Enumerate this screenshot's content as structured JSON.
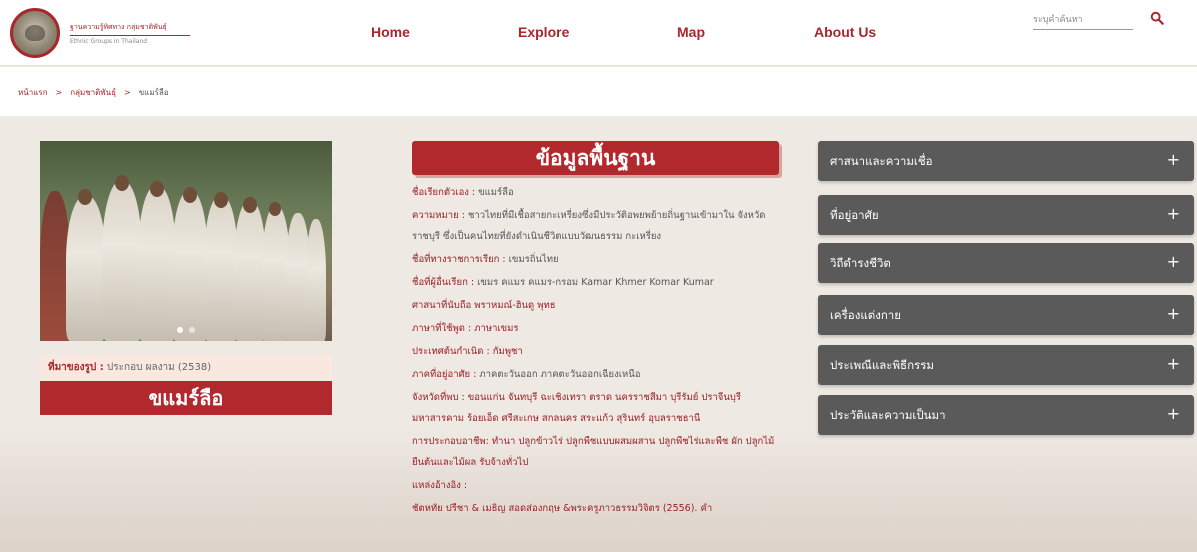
{
  "header": {
    "logo_line1": "ฐานความรู้ทิศทาง กลุ่มชาติพันธุ์",
    "logo_line2": "Ethnic Groups in Thailand",
    "nav": [
      {
        "label": "Home"
      },
      {
        "label": "Explore"
      },
      {
        "label": "Map"
      },
      {
        "label": "About Us"
      }
    ],
    "search_placeholder": "ระบุคำค้นหา",
    "search_icon": "search-icon"
  },
  "breadcrumb": {
    "items": [
      "หน้าแรก",
      "กลุ่มชาติพันธุ์",
      "ขแมร์ลือ"
    ],
    "separator": ">"
  },
  "left": {
    "credit_label": "ที่มาของรูป :",
    "credit_value": "ประกอบ ผลงาม (2538)",
    "name": "ขแมร์ลือ"
  },
  "main": {
    "title": "ข้อมูลพื้นฐาน",
    "rows": [
      {
        "label": "ชื่อเรียกตัวเอง :",
        "value": "ขแมร์ลือ"
      },
      {
        "label": "ความหมาย :",
        "value": "ชาวไทยที่มีเชื้อสายกะเหรี่ยงซึ่งมีประวัติอพยพย้ายถิ่นฐานเข้ามาใน จังหวัดราชบุรี ซึ่งเป็นคนไทยที่ยังดำเนินชีวิตแบบวัฒนธรรม กะเหรี่ยง"
      },
      {
        "label": "ชื่อที่ทางราชการเรียก :",
        "value": "เขมรถิ่นไทย"
      },
      {
        "label": "ชื่อที่ผู้อื่นเรียก :",
        "value": "เขมร คแมร คแมร-กรอม Kamar Khmer Komar Kumar"
      },
      {
        "label": "ศาสนาที่นับถือ",
        "value": "พราหมณ์-ฮินดู พุทธ"
      },
      {
        "label": "ภาษาที่ใช้พูด :",
        "value": "ภาษาเขมร"
      },
      {
        "label": "ประเทศต้นกำเนิด :",
        "value": "กัมพูชา"
      },
      {
        "label": "ภาคที่อยู่อาศัย :",
        "value": "ภาคตะวันออก ภาคตะวันออกเฉียงเหนือ"
      },
      {
        "label": "จังหวัดที่พบ :",
        "value": "ขอนแก่น จันทบุรี ฉะเชิงเทรา ตราด นครราชสีมา บุรีรัมย์ ปราจีนบุรี มหาสารคาม ร้อยเอ็ด ศรีสะเกษ สกลนคร สระแก้ว สุรินทร์ อุบลราชธานี"
      },
      {
        "label": "การประกอบอาชีพ:",
        "value": "ทำนา ปลูกข้าวไร่ ปลูกพืชแบบผสมผสาน ปลูกพืชไร่และพืช ผัก ปลูกไม้ยืนต้นและไม้ผล รับจ้างทั่วไป"
      },
      {
        "label": "แหล่งอ้างอิง :",
        "value": ""
      },
      {
        "label": "",
        "value": "ชัตหทัย ปรีชา & เมธิญ สอดส่องกฤษ &พระครูภาวธรรมวิจิตร (2556). คำ"
      }
    ]
  },
  "accordion": [
    {
      "label": "ศาสนาและความเชื่อ",
      "icon": "+"
    },
    {
      "label": "ที่อยู่อาศัย",
      "icon": "+"
    },
    {
      "label": "วิถีดำรงชีวิต",
      "icon": "+"
    },
    {
      "label": "เครื่องแต่งกาย",
      "icon": "+"
    },
    {
      "label": "ประเพณีและพิธีกรรม",
      "icon": "+"
    },
    {
      "label": "ประวัติและความเป็นมา",
      "icon": "+"
    }
  ],
  "colors": {
    "brand": "#b1282d",
    "accordion": "#5a5a5a",
    "background": "#efe9e4"
  }
}
